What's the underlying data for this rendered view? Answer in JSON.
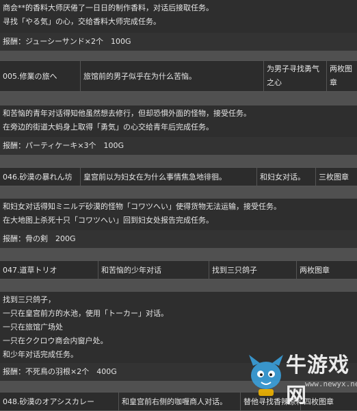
{
  "blocks": {
    "b1": {
      "lines": [
        "商会**的香料大师厌倦了一日日的制作香料，对话后接取任务。",
        "寻找「やる気」の心，交给香料大师完成任务。"
      ],
      "reward": "报酬：ジューシーサンド×2个　100G"
    },
    "q005": {
      "name": "005.修業の旅へ",
      "desc": "旅馆前的男子似乎在为什么苦恼。",
      "goal": "为男子寻找勇气之心",
      "medal": "两枚图章",
      "lines": [
        "和苦恼的青年对话得知他虽然想去修行，但却恐惧外面的怪物，接受任务。",
        "在旁边的街道大蚂身上取得「勇気」の心交给青年后完成任务。"
      ],
      "reward": "报酬：パーティケーキ×3个　100G"
    },
    "q046": {
      "name": "046.砂漠の暴れん坊",
      "desc": "皇宫前以为妇女在为什么事情焦急地徘徊。",
      "goal": "和妇女对话。",
      "medal": "三枚图章",
      "lines": [
        "和妇女对话得知ミニルデ砂漠的怪物「コワツへい」使得货物无法运输，接受任务。",
        "在大地图上杀死十只「コワツへい」回到妇女处报告完成任务。"
      ],
      "reward": "报酬：骨の剣　200G"
    },
    "q047": {
      "name": "047.道草トリオ",
      "desc": "和苦恼的少年对话",
      "goal": "找到三只鸽子",
      "medal": "两枚图章",
      "lines": [
        "找到三只鸽子，",
        "一只在皇宫前方的水池，使用「トーカー」对话。",
        "一只在旅馆广场处",
        "一只在ククロウ商会内窗户处。",
        "和少年对话完成任务。"
      ],
      "reward": "报酬：不死鳥の羽根×2个　400G"
    },
    "q048": {
      "name": "048.砂漠のオアシスカレー",
      "desc": "和皇宫前右侧的咖喱商人对话。",
      "goal": "替他寻找香辣原料",
      "medal": "四枚图章"
    }
  },
  "watermark": {
    "text": "牛游戏网",
    "url": "www.newyx.net"
  }
}
